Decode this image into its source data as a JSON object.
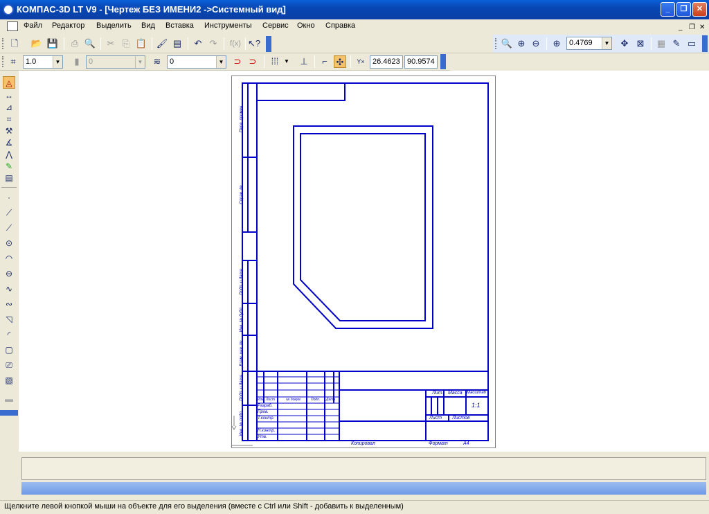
{
  "window": {
    "title": "КОМПАС-3D LT V9 - [Чертеж БЕЗ ИМЕНИ2 ->Системный вид]",
    "controls": {
      "minimize": "_",
      "restore": "❐",
      "close": "✕"
    }
  },
  "menu": {
    "items": [
      "Файл",
      "Редактор",
      "Выделить",
      "Вид",
      "Вставка",
      "Инструменты",
      "Сервис",
      "Окно",
      "Справка"
    ],
    "doc_controls": {
      "minimize": "_",
      "restore": "❐",
      "close": "✕"
    }
  },
  "view_toolbar": {
    "zoom_value": "0.4769"
  },
  "prop_toolbar": {
    "step_value": "1.0",
    "style_value": "0",
    "layer_value": "0",
    "coord_x": "26.4623",
    "coord_y": "90.9574",
    "coord_icon_label": "Y×"
  },
  "title_block": {
    "headers": {
      "lit": "Лит.",
      "massa": "Масса",
      "masshtab": "Масштаб",
      "list": "Лист",
      "listov": "Листов"
    },
    "scale_value": "1:1",
    "rows": {
      "izm": "Изм.",
      "list_col": "Лист",
      "doc": "№ докум.",
      "podp": "Подп.",
      "data": "Дата",
      "razrab": "Разраб.",
      "prov": "Пров.",
      "tkontr": "Т.контр.",
      "nkontr": "Н.контр.",
      "utv": "Утв."
    },
    "footer_copy": "Копировал",
    "footer_format": "Формат",
    "footer_format_value": "А4",
    "side_labels": [
      "Перв. примен.",
      "Справ. №",
      "Подп. и дата",
      "Инв. № дубл.",
      "Взам. инв. №",
      "Подп. и дата",
      "Инв. № подл."
    ]
  },
  "status": {
    "hint": "Щелкните левой кнопкой мыши на объекте для его выделения (вместе с Ctrl или Shift - добавить к выделенным)"
  },
  "colors": {
    "titlebar": "#0a47b3",
    "drawing": "#0000c8",
    "accent": "#f5a623"
  }
}
